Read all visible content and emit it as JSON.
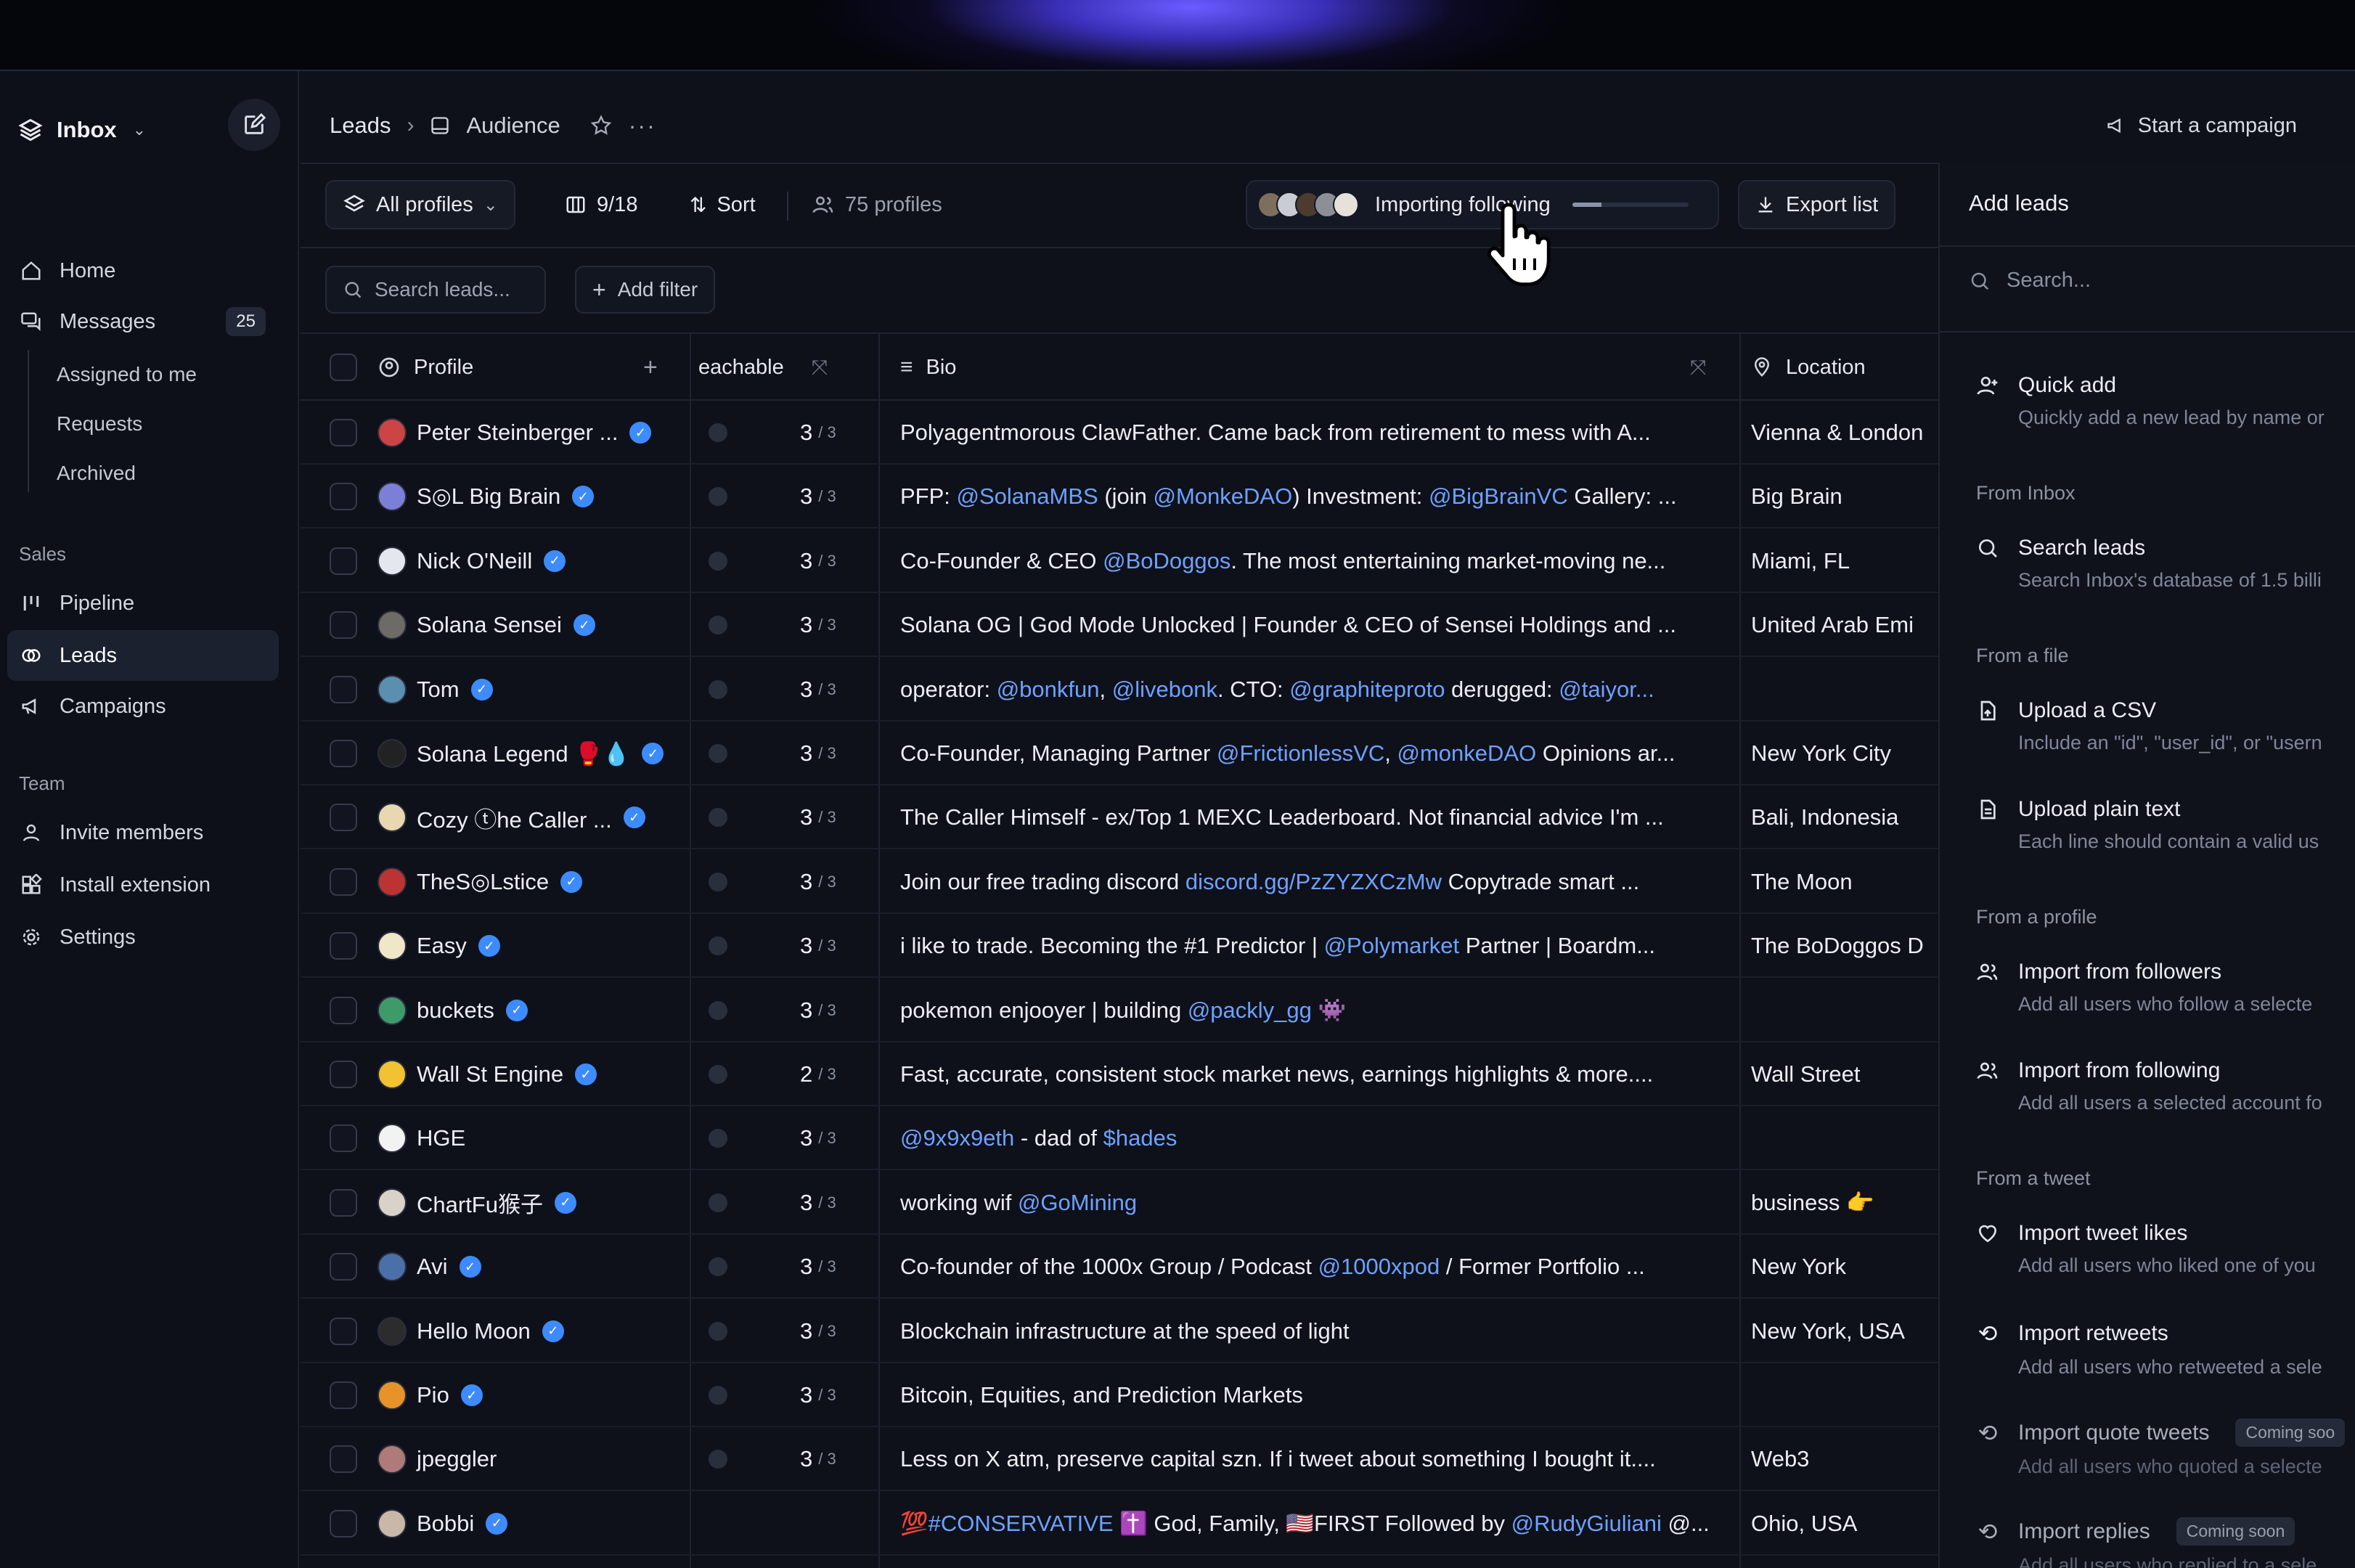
{
  "colors": {
    "accent": "#3d8bff",
    "link": "#6ea1ff",
    "glow": "#6a5cff"
  },
  "sidebar": {
    "workspace": "Inbox",
    "nav": [
      {
        "label": "Home",
        "icon": "home-icon"
      },
      {
        "label": "Messages",
        "icon": "messages-icon",
        "count": "25"
      }
    ],
    "sub": [
      "Assigned to me",
      "Requests",
      "Archived"
    ],
    "sales_label": "Sales",
    "sales": [
      {
        "label": "Pipeline",
        "icon": "pipeline-icon"
      },
      {
        "label": "Leads",
        "icon": "leads-icon",
        "active": true
      },
      {
        "label": "Campaigns",
        "icon": "megaphone-icon"
      }
    ],
    "team_label": "Team",
    "team": [
      {
        "label": "Invite members",
        "icon": "user-icon"
      },
      {
        "label": "Install extension",
        "icon": "extension-icon"
      },
      {
        "label": "Settings",
        "icon": "gear-icon"
      }
    ]
  },
  "header": {
    "crumb_root": "Leads",
    "crumb_current": "Audience",
    "campaign_label": "Start a campaign"
  },
  "toolbar": {
    "all_profiles": "All profiles",
    "columns": "9/18",
    "sort": "Sort",
    "profiles_count": "75 profiles",
    "importing": "Importing following",
    "import_progress": 0.25,
    "export": "Export list"
  },
  "filters": {
    "search_placeholder": "Search leads...",
    "add_filter": "Add filter"
  },
  "columns": {
    "profile": "Profile",
    "reachable": "eachable",
    "bio": "Bio",
    "location": "Location"
  },
  "rows": [
    {
      "name": "Peter Steinberger ...",
      "v": true,
      "reach": "3",
      "of": "/ 3",
      "bio": [
        [
          "Polyagentmorous ClawFather. Came back from retirement to mess with A...",
          0
        ]
      ],
      "loc": "Vienna & London",
      "av": "#c44"
    },
    {
      "name": "S◎L Big Brain",
      "v": true,
      "reach": "3",
      "of": "/ 3",
      "bio": [
        [
          "PFP: ",
          0
        ],
        [
          "@SolanaMBS",
          1
        ],
        [
          " (join ",
          0
        ],
        [
          "@MonkeDAO",
          1
        ],
        [
          ") Investment: ",
          0
        ],
        [
          "@BigBrainVC",
          1
        ],
        [
          " Gallery: ...",
          0
        ]
      ],
      "loc": "Big Brain",
      "av": "#7b7fd8"
    },
    {
      "name": "Nick O'Neill",
      "v": true,
      "reach": "3",
      "of": "/ 3",
      "bio": [
        [
          "Co-Founder & CEO ",
          0
        ],
        [
          "@BoDoggos",
          1
        ],
        [
          ". The most entertaining market-moving ne...",
          0
        ]
      ],
      "loc": "Miami, FL",
      "av": "#e5e7ee"
    },
    {
      "name": "Solana Sensei",
      "v": true,
      "reach": "3",
      "of": "/ 3",
      "bio": [
        [
          "Solana OG | God Mode Unlocked | Founder & CEO of Sensei Holdings and ...",
          0
        ]
      ],
      "loc": "United Arab Emi",
      "av": "#6e6a66"
    },
    {
      "name": "Tom",
      "v": true,
      "reach": "3",
      "of": "/ 3",
      "bio": [
        [
          "operator: ",
          0
        ],
        [
          "@bonkfun",
          1
        ],
        [
          ", ",
          0
        ],
        [
          "@livebonk",
          1
        ],
        [
          ". CTO: ",
          0
        ],
        [
          "@graphiteproto",
          1
        ],
        [
          " derugged: ",
          0
        ],
        [
          "@taiyor...",
          1
        ]
      ],
      "loc": "",
      "av": "#5a8fb0"
    },
    {
      "name": "Solana Legend 🥊💧",
      "v": true,
      "reach": "3",
      "of": "/ 3",
      "bio": [
        [
          "Co-Founder, Managing Partner ",
          0
        ],
        [
          "@FrictionlessVC",
          1
        ],
        [
          ", ",
          0
        ],
        [
          "@monkeDAO",
          1
        ],
        [
          " Opinions ar...",
          0
        ]
      ],
      "loc": "New York City",
      "av": "#222"
    },
    {
      "name": "Cozy ⓣhe Caller ...",
      "v": true,
      "reach": "3",
      "of": "/ 3",
      "bio": [
        [
          "The Caller Himself - ex/Top 1 MEXC Leaderboard. Not financial advice I'm ...",
          0
        ]
      ],
      "loc": "Bali, Indonesia",
      "av": "#e8d7b0"
    },
    {
      "name": "TheS◎Lstice",
      "v": true,
      "reach": "3",
      "of": "/ 3",
      "bio": [
        [
          "Join our free trading discord ",
          0
        ],
        [
          "discord.gg/PzZYZXCzMw",
          1
        ],
        [
          " Copytrade smart ...",
          0
        ]
      ],
      "loc": "The Moon",
      "av": "#b33"
    },
    {
      "name": "Easy",
      "v": true,
      "reach": "3",
      "of": "/ 3",
      "bio": [
        [
          "i like to trade. Becoming the #1 Predictor | ",
          0
        ],
        [
          "@Polymarket",
          1
        ],
        [
          " Partner | Boardm...",
          0
        ]
      ],
      "loc": "The BoDoggos D",
      "av": "#f0e6c8"
    },
    {
      "name": "buckets",
      "v": true,
      "reach": "3",
      "of": "/ 3",
      "bio": [
        [
          "pokemon enjooyer | building ",
          0
        ],
        [
          "@packly_gg",
          1
        ],
        [
          " 👾",
          0
        ]
      ],
      "loc": "",
      "av": "#3f9a6a"
    },
    {
      "name": "Wall St Engine",
      "v": true,
      "reach": "2",
      "of": "/ 3",
      "bio": [
        [
          "Fast, accurate, consistent stock market news, earnings highlights & more....",
          0
        ]
      ],
      "loc": "Wall Street",
      "av": "#f1c232"
    },
    {
      "name": "HGE",
      "v": false,
      "reach": "3",
      "of": "/ 3",
      "bio": [
        [
          "@9x9x9eth",
          1
        ],
        [
          " - dad of ",
          0
        ],
        [
          "$hades",
          1
        ]
      ],
      "loc": "",
      "av": "#f2f2f2"
    },
    {
      "name": "ChartFu猴子",
      "v": true,
      "reach": "3",
      "of": "/ 3",
      "bio": [
        [
          "working wif ",
          0
        ],
        [
          "@GoMining",
          1
        ]
      ],
      "loc": "business 👉",
      "av": "#d9d2c8"
    },
    {
      "name": "Avi",
      "v": true,
      "reach": "3",
      "of": "/ 3",
      "bio": [
        [
          "Co-founder of the 1000x Group / Podcast ",
          0
        ],
        [
          "@1000xpod",
          1
        ],
        [
          " / Former Portfolio ...",
          0
        ]
      ],
      "loc": "New York",
      "av": "#4b6fa8"
    },
    {
      "name": "Hello Moon",
      "v": true,
      "reach": "3",
      "of": "/ 3",
      "bio": [
        [
          "Blockchain infrastructure at the speed of light",
          0
        ]
      ],
      "loc": "New York, USA",
      "av": "#2c2c2c"
    },
    {
      "name": "Pio",
      "v": true,
      "reach": "3",
      "of": "/ 3",
      "bio": [
        [
          "Bitcoin, Equities, and Prediction Markets",
          0
        ]
      ],
      "loc": "",
      "av": "#e8922a"
    },
    {
      "name": "jpeggler",
      "v": false,
      "reach": "3",
      "of": "/ 3",
      "bio": [
        [
          "Less on X atm, preserve capital szn. If i tweet about something I bought it....",
          0
        ]
      ],
      "loc": "Web3",
      "av": "#b07a7a"
    },
    {
      "name": "Bobbi",
      "v": true,
      "reach": "",
      "of": "",
      "bio": [
        [
          "💯#CONSERVATIVE ✝️",
          1
        ],
        [
          " God, Family, 🇺🇸FIRST Followed by ",
          0
        ],
        [
          "@RudyGiuliani",
          1
        ],
        [
          " @...",
          0
        ]
      ],
      "loc": "Ohio, USA",
      "av": "#c9b8a8"
    }
  ],
  "panel": {
    "title": "Add leads",
    "search_placeholder": "Search...",
    "quick_add": {
      "t": "Quick add",
      "d": "Quickly add a new lead by name or"
    },
    "from_inbox": "From Inbox",
    "search_leads": {
      "t": "Search leads",
      "d": "Search Inbox's database of 1.5 billi"
    },
    "from_file": "From a file",
    "upload_csv": {
      "t": "Upload a CSV",
      "d": "Include an \"id\", \"user_id\", or \"usern"
    },
    "upload_text": {
      "t": "Upload plain text",
      "d": "Each line should contain a valid us"
    },
    "from_profile": "From a profile",
    "followers": {
      "t": "Import from followers",
      "d": "Add all users who follow a selecte"
    },
    "following": {
      "t": "Import from following",
      "d": "Add all users a selected account fo"
    },
    "from_tweet": "From a tweet",
    "likes": {
      "t": "Import tweet likes",
      "d": "Add all users who liked one of you"
    },
    "retweets": {
      "t": "Import retweets",
      "d": "Add all users who retweeted a sele"
    },
    "quotes": {
      "t": "Import quote tweets",
      "d": "Add all users who quoted a selecte",
      "badge": "Coming soo"
    },
    "replies": {
      "t": "Import replies",
      "d": "Add all users who replied to a sele",
      "badge": "Coming soon"
    }
  }
}
